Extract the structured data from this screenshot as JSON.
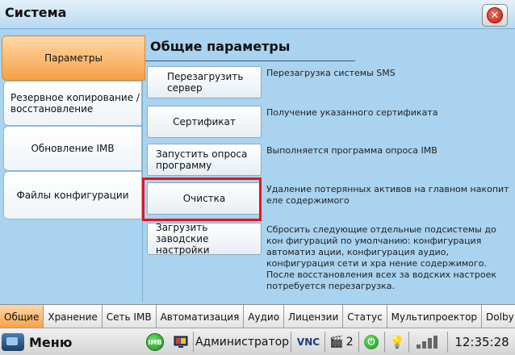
{
  "window": {
    "title": "Система",
    "close_icon": "close-icon"
  },
  "left_tabs": [
    {
      "label": "Параметры",
      "active": true
    },
    {
      "label": "Резервное копирование / восстановление",
      "active": false
    },
    {
      "label": "Обновление IMB",
      "active": false
    },
    {
      "label": "Файлы конфигурации",
      "active": false
    }
  ],
  "panel": {
    "title": "Общие параметры",
    "actions": [
      {
        "label": "Перезагрузить сервер",
        "description": "Перезагрузка системы SMS"
      },
      {
        "label": "Сертификат",
        "description": "Получение указанного сертификата"
      },
      {
        "label": "Запустить опроса программу",
        "description": "Выполняется программа опроса IMB"
      },
      {
        "label": "Очистка",
        "description": "Удаление потерянных активов на главном накопит еле содержимого"
      },
      {
        "label": "Загрузить заводские настройки",
        "description": "Сбросить следующие отдельные подсистемы до кон фигураций по умолчанию:  конфигурация автоматиз ации, конфигурация аудио, конфигурация сети и хра нение содержимого. После восстановления всех за водских настроек потребуется перезагрузка."
      }
    ]
  },
  "bottom_tabs": [
    {
      "label": "Общие",
      "active": true
    },
    {
      "label": "Хранение",
      "active": false
    },
    {
      "label": "Сеть IMB",
      "active": false
    },
    {
      "label": "Автоматизация",
      "active": false
    },
    {
      "label": "Аудио",
      "active": false
    },
    {
      "label": "Лицензии",
      "active": false
    },
    {
      "label": "Статус",
      "active": false
    },
    {
      "label": "Мультипроектор",
      "active": false
    },
    {
      "label": "Dolby At",
      "active": false
    }
  ],
  "statusbar": {
    "menu_label": "Меню",
    "imb_badge": "IMB",
    "user": "Администратор",
    "vnc": "VNC",
    "count": "2",
    "time": "12:35:28",
    "colors": {
      "accent_orange": "#f6a045",
      "highlight_red": "#e0161e",
      "bg_blue": "#a9d3ee"
    }
  }
}
